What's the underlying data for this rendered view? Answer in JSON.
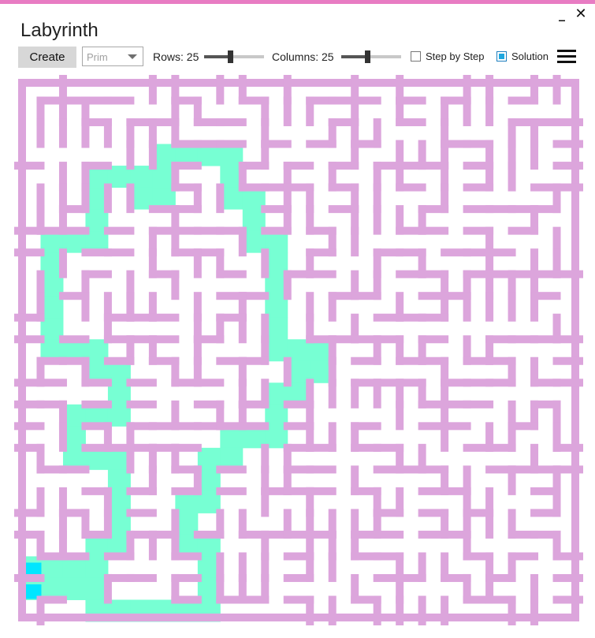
{
  "window": {
    "accent_color": "#e87cc3",
    "minimize_glyph": "_",
    "close_glyph": "✕"
  },
  "app": {
    "title": "Labyrinth"
  },
  "toolbar": {
    "create_label": "Create",
    "algorithm": {
      "selected": "Prim"
    },
    "rows": {
      "label": "Rows: 25",
      "value": 25
    },
    "columns": {
      "label": "Columns: 25",
      "value": 25
    },
    "step_by_step": {
      "label": "Step by Step",
      "checked": false
    },
    "solution": {
      "label": "Solution",
      "checked": true
    },
    "menu_icon": "hamburger-icon"
  },
  "maze": {
    "rows": 25,
    "columns": 25,
    "wall_color": "#dca5dc",
    "path_color": "#77ffd3",
    "endpoint_color": "#00e6ff",
    "start_cell": [
      22,
      0
    ],
    "end_cell": [
      23,
      0
    ]
  }
}
